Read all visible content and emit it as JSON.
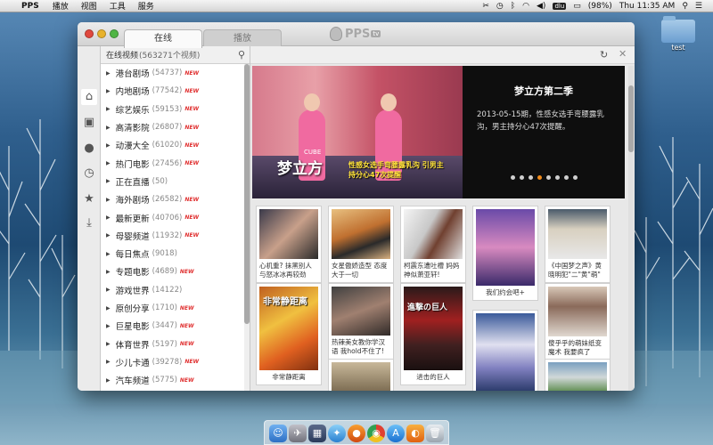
{
  "menubar": {
    "apple": "",
    "app_name": "PPS",
    "menus": [
      "播放",
      "视图",
      "工具",
      "服务"
    ],
    "battery": "(98%)",
    "clock": "Thu 11:35 AM"
  },
  "desktop": {
    "folder_label": "test"
  },
  "window": {
    "tabs": [
      "在线",
      "播放"
    ],
    "logo": "PPS",
    "logo_badge": "tv"
  },
  "sidebar": {
    "header_title": "在线视频",
    "header_count": "(563271个视频)",
    "categories": [
      {
        "name": "港台剧场",
        "count": "(54737)",
        "new": true
      },
      {
        "name": "内地剧场",
        "count": "(77542)",
        "new": true
      },
      {
        "name": "综艺娱乐",
        "count": "(59153)",
        "new": true
      },
      {
        "name": "高清影院",
        "count": "(26807)",
        "new": true
      },
      {
        "name": "动漫大全",
        "count": "(61020)",
        "new": true
      },
      {
        "name": "热门电影",
        "count": "(27456)",
        "new": true
      },
      {
        "name": "正在直播",
        "count": "(50)",
        "new": false
      },
      {
        "name": "海外剧场",
        "count": "(26582)",
        "new": true
      },
      {
        "name": "最新更新",
        "count": "(40706)",
        "new": true
      },
      {
        "name": "母婴频道",
        "count": "(11932)",
        "new": true
      },
      {
        "name": "每日焦点",
        "count": "(9018)",
        "new": false
      },
      {
        "name": "专题电影",
        "count": "(4689)",
        "new": true
      },
      {
        "name": "游戏世界",
        "count": "(14122)",
        "new": false
      },
      {
        "name": "原创分享",
        "count": "(1710)",
        "new": true
      },
      {
        "name": "巨星电影",
        "count": "(3447)",
        "new": true
      },
      {
        "name": "体育世界",
        "count": "(5197)",
        "new": true
      },
      {
        "name": "少儿卡通",
        "count": "(39278)",
        "new": true
      },
      {
        "name": "汽车频道",
        "count": "(5775)",
        "new": true
      }
    ],
    "new_badge": "NEW"
  },
  "banner": {
    "brand_cube": "CUBE",
    "brand": "梦立方",
    "caption": "性感女选手弯腰露乳沟 引男主持分心47次提醒",
    "promo_title": "梦立方第二季",
    "promo_desc": "2013-05-15期，性感女选手弯腰露乳沟，男主持分心47次提醒。",
    "dots": 8,
    "active_dot": 3
  },
  "grid": [
    {
      "text": "心机重? 抹黑别人与怒冰冰再较劲"
    },
    {
      "text": "女星傲娇造型 态度大于一切"
    },
    {
      "text": "柯震东遭吐槽 妈妈神似萧亚轩!"
    },
    {
      "text": "我们约会吧+"
    },
    {
      "text": "《中国梦之声》黄晓明犯\"二\"黄\"萌\""
    },
    {
      "text": "非常静距离",
      "img_title": "非常静距离"
    },
    {
      "text": "热辣美女教你学汉语 我hold不住了!"
    },
    {
      "text": "进击的巨人",
      "img_title": "進撃の巨人"
    },
    {
      "text": ""
    },
    {
      "text": "傻乎乎的萌妹纸变魔术 我要疯了"
    },
    {
      "text": ""
    }
  ],
  "dock": [
    "finder",
    "launchpad",
    "mission-control",
    "safari",
    "firefox",
    "chrome",
    "app-store",
    "pps",
    "trash"
  ]
}
